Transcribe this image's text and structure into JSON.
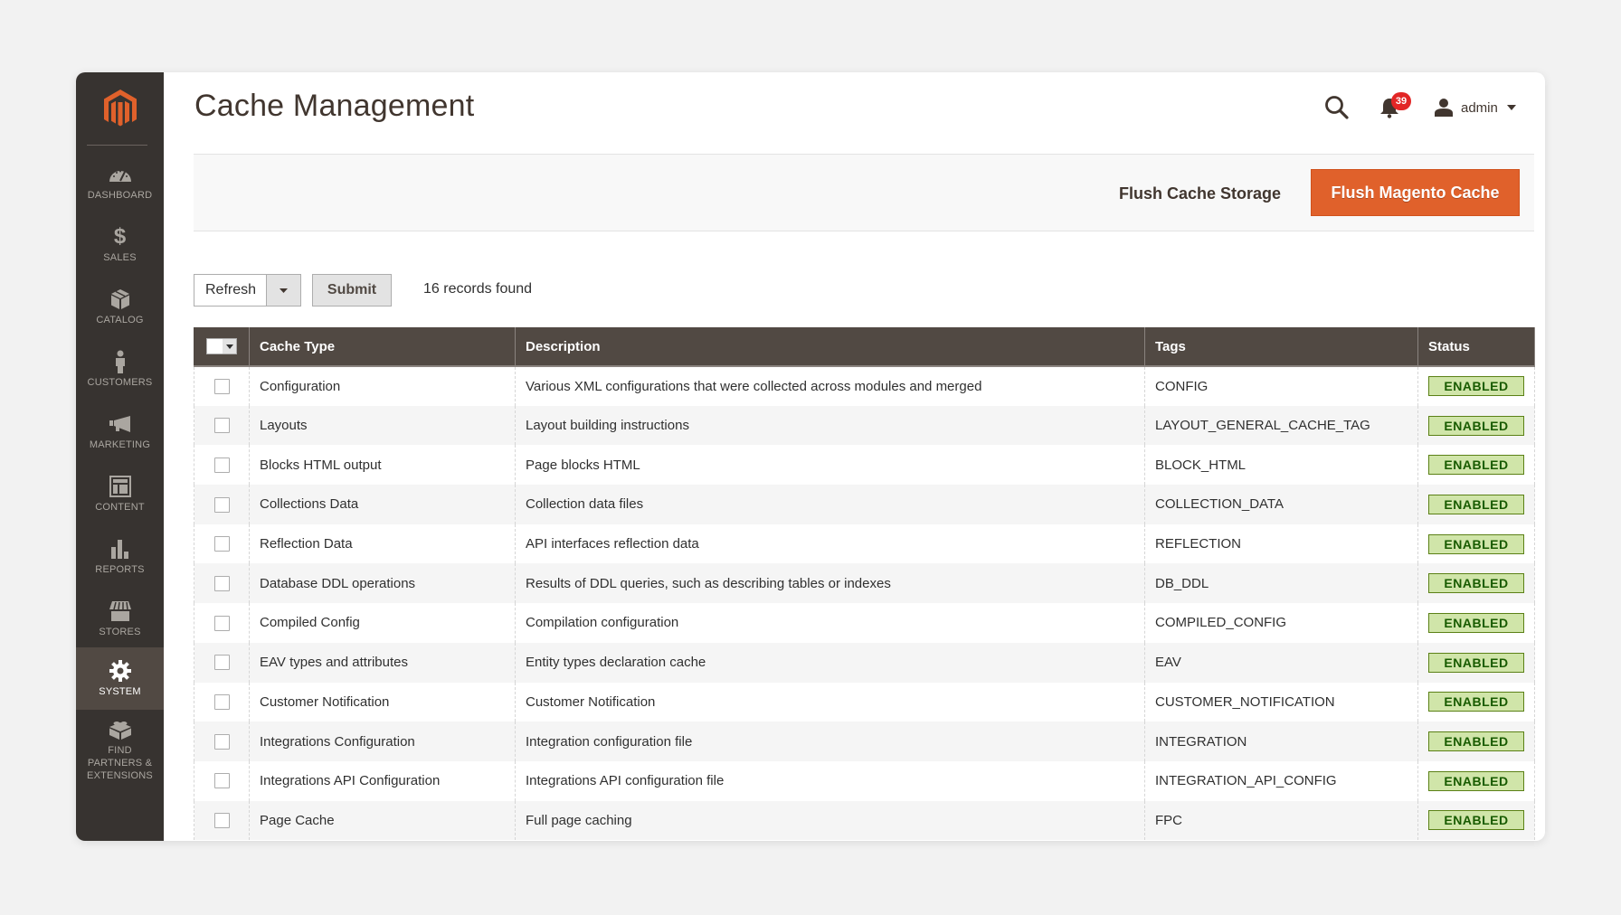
{
  "sidebar": {
    "logo": "magento-logo",
    "items": [
      {
        "label": "DASHBOARD",
        "icon": "dashboard-icon",
        "active": false
      },
      {
        "label": "SALES",
        "icon": "dollar-icon",
        "active": false
      },
      {
        "label": "CATALOG",
        "icon": "box-icon",
        "active": false
      },
      {
        "label": "CUSTOMERS",
        "icon": "person-icon",
        "active": false
      },
      {
        "label": "MARKETING",
        "icon": "megaphone-icon",
        "active": false
      },
      {
        "label": "CONTENT",
        "icon": "layout-icon",
        "active": false
      },
      {
        "label": "REPORTS",
        "icon": "bar-chart-icon",
        "active": false
      },
      {
        "label": "STORES",
        "icon": "storefront-icon",
        "active": false
      },
      {
        "label": "SYSTEM",
        "icon": "gear-icon",
        "active": true
      },
      {
        "label": "FIND PARTNERS & EXTENSIONS",
        "icon": "lego-brick-icon",
        "active": false
      }
    ]
  },
  "header": {
    "title": "Cache Management",
    "notifications_count": "39",
    "user_name": "admin"
  },
  "actions": {
    "flush_cache_storage": "Flush Cache Storage",
    "flush_magento_cache": "Flush Magento Cache"
  },
  "controls": {
    "mass_action_value": "Refresh",
    "submit_label": "Submit",
    "records_found": "16 records found"
  },
  "grid": {
    "columns": [
      "Cache Type",
      "Description",
      "Tags",
      "Status"
    ],
    "rows": [
      {
        "cache_type": "Configuration",
        "description": "Various XML configurations that were collected across modules and merged",
        "tags": "CONFIG",
        "status": "ENABLED"
      },
      {
        "cache_type": "Layouts",
        "description": "Layout building instructions",
        "tags": "LAYOUT_GENERAL_CACHE_TAG",
        "status": "ENABLED"
      },
      {
        "cache_type": "Blocks HTML output",
        "description": "Page blocks HTML",
        "tags": "BLOCK_HTML",
        "status": "ENABLED"
      },
      {
        "cache_type": "Collections Data",
        "description": "Collection data files",
        "tags": "COLLECTION_DATA",
        "status": "ENABLED"
      },
      {
        "cache_type": "Reflection Data",
        "description": "API interfaces reflection data",
        "tags": "REFLECTION",
        "status": "ENABLED"
      },
      {
        "cache_type": "Database DDL operations",
        "description": "Results of DDL queries, such as describing tables or indexes",
        "tags": "DB_DDL",
        "status": "ENABLED"
      },
      {
        "cache_type": "Compiled Config",
        "description": "Compilation configuration",
        "tags": "COMPILED_CONFIG",
        "status": "ENABLED"
      },
      {
        "cache_type": "EAV types and attributes",
        "description": "Entity types declaration cache",
        "tags": "EAV",
        "status": "ENABLED"
      },
      {
        "cache_type": "Customer Notification",
        "description": "Customer Notification",
        "tags": "CUSTOMER_NOTIFICATION",
        "status": "ENABLED"
      },
      {
        "cache_type": "Integrations Configuration",
        "description": "Integration configuration file",
        "tags": "INTEGRATION",
        "status": "ENABLED"
      },
      {
        "cache_type": "Integrations API Configuration",
        "description": "Integrations API configuration file",
        "tags": "INTEGRATION_API_CONFIG",
        "status": "ENABLED"
      },
      {
        "cache_type": "Page Cache",
        "description": "Full page caching",
        "tags": "FPC",
        "status": "ENABLED"
      }
    ]
  },
  "colors": {
    "accent": "#e0612b",
    "sidebar_bg": "#373330",
    "grid_header_bg": "#514943",
    "status_enabled_bg": "#d0e5a9",
    "status_enabled_text": "#185b00",
    "notification_badge": "#e22626"
  }
}
